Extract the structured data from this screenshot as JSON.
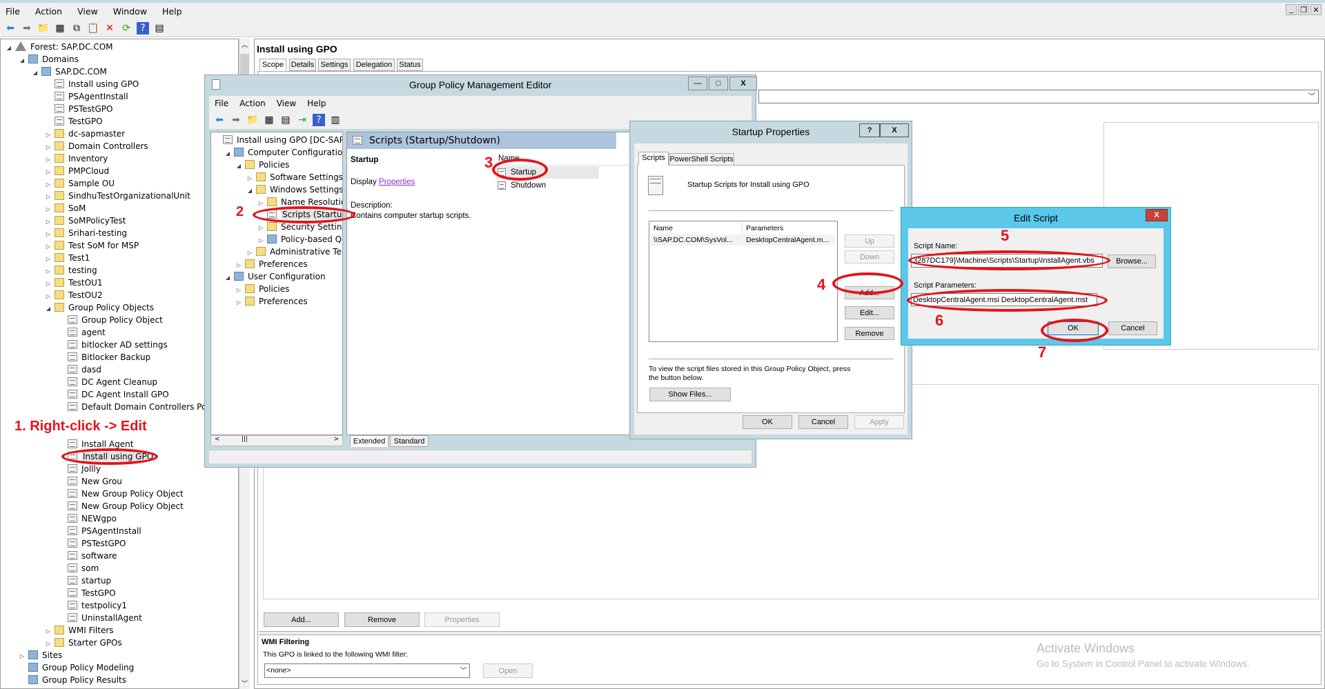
{
  "menu": [
    "File",
    "Action",
    "View",
    "Window",
    "Help"
  ],
  "tree": [
    {
      "t": "Forest: SAP.DC.COM",
      "l": 0,
      "e": "open",
      "i": "forest"
    },
    {
      "t": "Domains",
      "l": 1,
      "e": "open",
      "i": "dom"
    },
    {
      "t": "SAP.DC.COM",
      "l": 2,
      "e": "open",
      "i": "dom"
    },
    {
      "t": "Install using GPO",
      "l": 3,
      "e": "",
      "i": "gpo"
    },
    {
      "t": "PSAgentInstall",
      "l": 3,
      "e": "",
      "i": "gpo"
    },
    {
      "t": "PSTestGPO",
      "l": 3,
      "e": "",
      "i": "gpo"
    },
    {
      "t": "TestGPO",
      "l": 3,
      "e": "",
      "i": "gpo"
    },
    {
      "t": "dc-sapmaster",
      "l": 3,
      "e": "closed",
      "i": "ou"
    },
    {
      "t": "Domain Controllers",
      "l": 3,
      "e": "closed",
      "i": "ou"
    },
    {
      "t": "Inventory",
      "l": 3,
      "e": "closed",
      "i": "ou"
    },
    {
      "t": "PMPCloud",
      "l": 3,
      "e": "closed",
      "i": "ou"
    },
    {
      "t": "Sample OU",
      "l": 3,
      "e": "closed",
      "i": "ou"
    },
    {
      "t": "SindhuTestOrganizationalUnit",
      "l": 3,
      "e": "closed",
      "i": "ou"
    },
    {
      "t": "SoM",
      "l": 3,
      "e": "closed",
      "i": "ou"
    },
    {
      "t": "SoMPolicyTest",
      "l": 3,
      "e": "closed",
      "i": "ou"
    },
    {
      "t": "Srihari-testing",
      "l": 3,
      "e": "closed",
      "i": "ou"
    },
    {
      "t": "Test SoM for MSP",
      "l": 3,
      "e": "closed",
      "i": "ou"
    },
    {
      "t": "Test1",
      "l": 3,
      "e": "closed",
      "i": "ou"
    },
    {
      "t": "testing",
      "l": 3,
      "e": "closed",
      "i": "ou"
    },
    {
      "t": "TestOU1",
      "l": 3,
      "e": "closed",
      "i": "ou"
    },
    {
      "t": "TestOU2",
      "l": 3,
      "e": "closed",
      "i": "ou"
    },
    {
      "t": "Group Policy Objects",
      "l": 3,
      "e": "open",
      "i": "ou"
    },
    {
      "t": "Group Policy Object",
      "l": 4,
      "e": "",
      "i": "gpo"
    },
    {
      "t": "agent",
      "l": 4,
      "e": "",
      "i": "gpo"
    },
    {
      "t": "bitlocker AD settings",
      "l": 4,
      "e": "",
      "i": "gpo"
    },
    {
      "t": "Bitlocker Backup",
      "l": 4,
      "e": "",
      "i": "gpo"
    },
    {
      "t": "dasd",
      "l": 4,
      "e": "",
      "i": "gpo"
    },
    {
      "t": "DC Agent Cleanup",
      "l": 4,
      "e": "",
      "i": "gpo"
    },
    {
      "t": "DC Agent Install GPO",
      "l": 4,
      "e": "",
      "i": "gpo"
    },
    {
      "t": "Default Domain Controllers Policy",
      "l": 4,
      "e": "",
      "i": "gpo"
    },
    {
      "t": "",
      "l": 4,
      "e": "",
      "i": ""
    },
    {
      "t": "",
      "l": 4,
      "e": "",
      "i": ""
    },
    {
      "t": "Install Agent",
      "l": 4,
      "e": "",
      "i": "gpo"
    },
    {
      "t": "Install using GPO",
      "l": 4,
      "e": "",
      "i": "gpo",
      "sel": true
    },
    {
      "t": "Jollly",
      "l": 4,
      "e": "",
      "i": "gpo"
    },
    {
      "t": "New Grou",
      "l": 4,
      "e": "",
      "i": "gpo"
    },
    {
      "t": "New Group Policy Object",
      "l": 4,
      "e": "",
      "i": "gpo"
    },
    {
      "t": "New Group Policy Object",
      "l": 4,
      "e": "",
      "i": "gpo"
    },
    {
      "t": "NEWgpo",
      "l": 4,
      "e": "",
      "i": "gpo"
    },
    {
      "t": "PSAgentInstall",
      "l": 4,
      "e": "",
      "i": "gpo"
    },
    {
      "t": "PSTestGPO",
      "l": 4,
      "e": "",
      "i": "gpo"
    },
    {
      "t": "software",
      "l": 4,
      "e": "",
      "i": "gpo"
    },
    {
      "t": "som",
      "l": 4,
      "e": "",
      "i": "gpo"
    },
    {
      "t": "startup",
      "l": 4,
      "e": "",
      "i": "gpo"
    },
    {
      "t": "TestGPO",
      "l": 4,
      "e": "",
      "i": "gpo"
    },
    {
      "t": "testpolicy1",
      "l": 4,
      "e": "",
      "i": "gpo"
    },
    {
      "t": "UninstallAgent",
      "l": 4,
      "e": "",
      "i": "gpo"
    },
    {
      "t": "WMI Filters",
      "l": 3,
      "e": "closed",
      "i": "ou"
    },
    {
      "t": "Starter GPOs",
      "l": 3,
      "e": "closed",
      "i": "ou"
    },
    {
      "t": "Sites",
      "l": 1,
      "e": "closed",
      "i": "dom"
    },
    {
      "t": "Group Policy Modeling",
      "l": 1,
      "e": "",
      "i": "dom"
    },
    {
      "t": "Group Policy Results",
      "l": 1,
      "e": "",
      "i": "dom"
    }
  ],
  "main": {
    "title": "Install using GPO",
    "tabs": [
      "Scope",
      "Details",
      "Settings",
      "Delegation",
      "Status"
    ],
    "buttons": {
      "add": "Add...",
      "remove": "Remove",
      "properties": "Properties"
    },
    "wmi": {
      "heading": "WMI Filtering",
      "text": "This GPO is linked to the following WMI filter:",
      "value": "<none>",
      "open": "Open"
    },
    "watermark": {
      "line1": "Activate Windows",
      "line2": "Go to System in Control Panel to activate Windows."
    }
  },
  "gpme": {
    "title": "Group Policy Management Editor",
    "menu": [
      "File",
      "Action",
      "View",
      "Help"
    ],
    "tree": [
      {
        "t": "Install using GPO [DC-SAPMAS",
        "l": 0,
        "e": "",
        "i": "gpo"
      },
      {
        "t": "Computer Configuration",
        "l": 1,
        "e": "open",
        "i": "dom"
      },
      {
        "t": "Policies",
        "l": 2,
        "e": "open",
        "i": "ou"
      },
      {
        "t": "Software Settings",
        "l": 3,
        "e": "closed",
        "i": "ou"
      },
      {
        "t": "Windows Settings",
        "l": 3,
        "e": "open",
        "i": "ou"
      },
      {
        "t": "Name Resolution",
        "l": 4,
        "e": "closed",
        "i": "ou"
      },
      {
        "t": "Scripts (Startup/S",
        "l": 4,
        "e": "",
        "i": "gpo",
        "sel": true
      },
      {
        "t": "Security Settings",
        "l": 4,
        "e": "closed",
        "i": "ou"
      },
      {
        "t": "Policy-based QoS",
        "l": 4,
        "e": "closed",
        "i": "dom"
      },
      {
        "t": "Administrative Temp",
        "l": 3,
        "e": "closed",
        "i": "ou"
      },
      {
        "t": "Preferences",
        "l": 2,
        "e": "closed",
        "i": "ou"
      },
      {
        "t": "User Configuration",
        "l": 1,
        "e": "open",
        "i": "dom"
      },
      {
        "t": "Policies",
        "l": 2,
        "e": "closed",
        "i": "ou"
      },
      {
        "t": "Preferences",
        "l": 2,
        "e": "closed",
        "i": "ou"
      }
    ],
    "header": "Scripts (Startup/Shutdown)",
    "section": "Startup",
    "display": "Display",
    "properties_link": "Properties",
    "desc_label": "Description:",
    "desc": "Contains computer startup scripts.",
    "col_name": "Name",
    "items": [
      "Startup",
      "Shutdown"
    ],
    "tabs": [
      "Extended",
      "Standard"
    ]
  },
  "startup": {
    "title": "Startup Properties",
    "help": "?",
    "close": "X",
    "tabs": [
      "Scripts",
      "PowerShell Scripts"
    ],
    "heading": "Startup Scripts for Install using GPO",
    "cols": [
      "Name",
      "Parameters"
    ],
    "row": [
      "\\\\SAP.DC.COM\\SysVol...",
      "DesktopCentralAgent.m..."
    ],
    "buttons": [
      "Up",
      "Down",
      "Add...",
      "Edit...",
      "Remove"
    ],
    "note": "To view the script files stored in this Group Policy Object, press the button below.",
    "show_files": "Show Files...",
    "ok": "OK",
    "cancel": "Cancel",
    "apply": "Apply"
  },
  "edit": {
    "title": "Edit Script",
    "close": "X",
    "name_label": "Script Name:",
    "name_value": "3287DC179}\\Machine\\Scripts\\Startup\\InstallAgent.vbs",
    "browse": "Browse...",
    "params_label": "Script Parameters:",
    "params_value": "DesktopCentralAgent.msi DesktopCentralAgent.mst",
    "ok": "OK",
    "cancel": "Cancel"
  },
  "annotations": {
    "a1": "1. Right-click -> Edit",
    "a2": "2",
    "a3": "3",
    "a4": "4",
    "a5": "5",
    "a6": "6",
    "a7": "7",
    "color": "#e3141b"
  }
}
